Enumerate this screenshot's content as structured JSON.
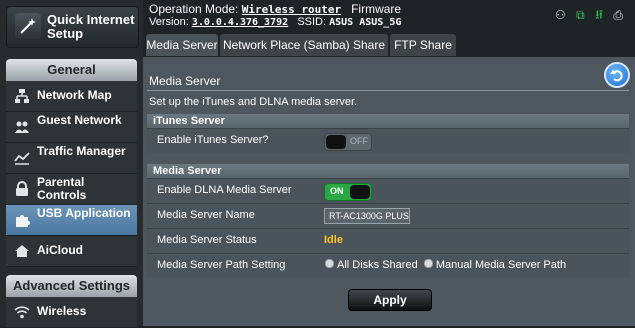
{
  "sidebar": {
    "quick_setup_label": "Quick Internet Setup",
    "general_header": "General",
    "general_items": [
      {
        "label": "Network Map",
        "icon": "network-map-icon",
        "active": false
      },
      {
        "label": "Guest Network",
        "icon": "guest-network-icon",
        "active": false
      },
      {
        "label": "Traffic Manager",
        "icon": "traffic-manager-icon",
        "active": false
      },
      {
        "label": "Parental Controls",
        "icon": "lock-icon",
        "active": false
      },
      {
        "label": "USB Application",
        "icon": "puzzle-icon",
        "active": true
      },
      {
        "label": "AiCloud",
        "icon": "cloud-home-icon",
        "active": false
      }
    ],
    "advanced_header": "Advanced Settings",
    "advanced_items": [
      {
        "label": "Wireless",
        "icon": "wifi-icon",
        "active": false
      }
    ]
  },
  "header": {
    "operation_mode_label": "Operation Mode:",
    "operation_mode_value": "Wireless router",
    "firmware_label": "Firmware",
    "version_label": "Version:",
    "version_value": "3.0.0.4.376_3792",
    "ssid_label": "SSID:",
    "ssid_value": "ASUS ASUS_5G"
  },
  "tabs": [
    {
      "label": "Media Server",
      "active": true
    },
    {
      "label": "Network Place (Samba) Share /",
      "active": false
    },
    {
      "label": "FTP Share",
      "active": false
    }
  ],
  "panel": {
    "title": "Media Server",
    "description": "Set up the iTunes and DLNA media server.",
    "itunes_group": {
      "header": "iTunes Server",
      "enable_label": "Enable iTunes Server?",
      "enable_state": "OFF"
    },
    "media_group": {
      "header": "Media Server",
      "dlna_label": "Enable DLNA Media Server",
      "dlna_state": "ON",
      "name_label": "Media Server Name",
      "name_value": "RT-AC1300G PLUS",
      "status_label": "Media Server Status",
      "status_value": "Idle",
      "path_label": "Media Server Path Setting",
      "path_option_all": "All Disks Shared",
      "path_option_manual": "Manual Media Server Path"
    },
    "apply_label": "Apply"
  },
  "colors": {
    "accent_active": "#4a77a0",
    "toggle_on": "#28a745",
    "status_idle": "#ffc125",
    "usb_icon": "#34c759"
  }
}
